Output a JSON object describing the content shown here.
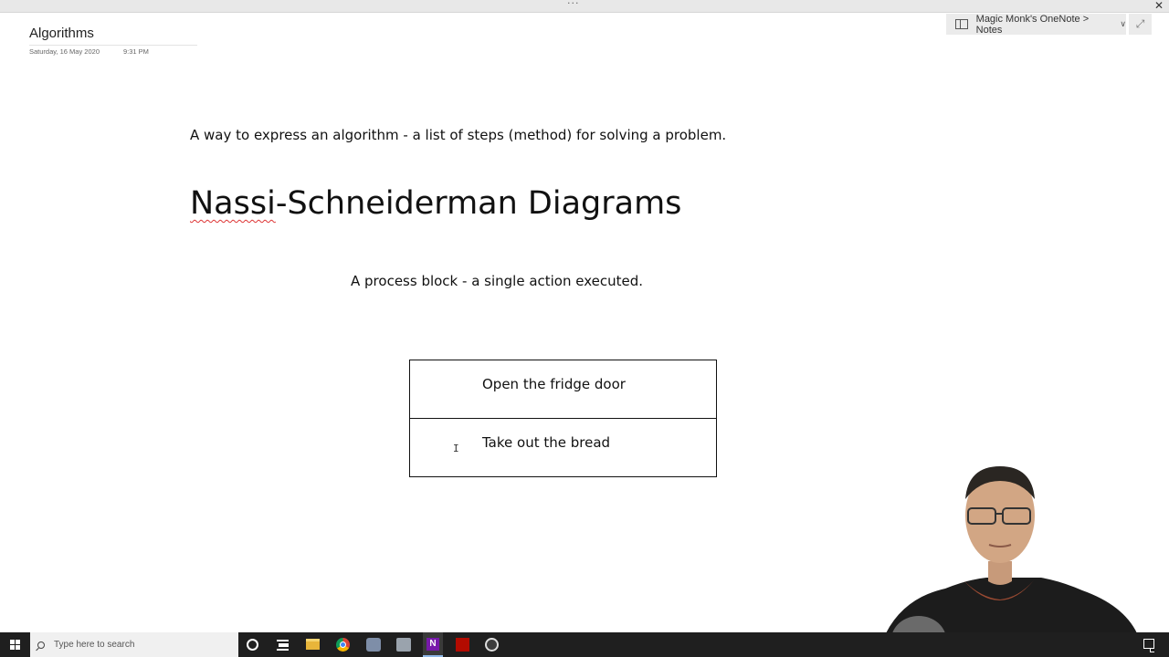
{
  "window": {
    "grip_label": "···",
    "close_label": "✕"
  },
  "breadcrumb": {
    "text": "Magic Monk's OneNote > Notes",
    "chevron": "∨",
    "expand_glyph": "⤢"
  },
  "page": {
    "title": "Algorithms",
    "date": "Saturday, 16 May 2020",
    "time": "9:31 PM"
  },
  "content": {
    "intro": "A way to express an algorithm - a list of steps (method) for solving a problem.",
    "heading_part1": "Nassi",
    "heading_part2": "-Schneiderman Diagrams",
    "description": "A process block - a single action executed."
  },
  "diagram": {
    "blocks": [
      {
        "label": "Open the fridge door"
      },
      {
        "label": "Take out the bread"
      }
    ]
  },
  "taskbar": {
    "search_placeholder": "Type here to search",
    "onenote_letter": "N",
    "icons": [
      "windows-start-icon",
      "search-icon",
      "cortana-icon",
      "task-view-icon",
      "file-explorer-icon",
      "chrome-icon",
      "app-icon",
      "app-icon",
      "onenote-icon",
      "acrobat-icon",
      "obs-icon",
      "notification-icon"
    ]
  },
  "colors": {
    "taskbar": "#1f1f1f",
    "spellcheck": "#dd3333",
    "onenote": "#7719aa"
  }
}
